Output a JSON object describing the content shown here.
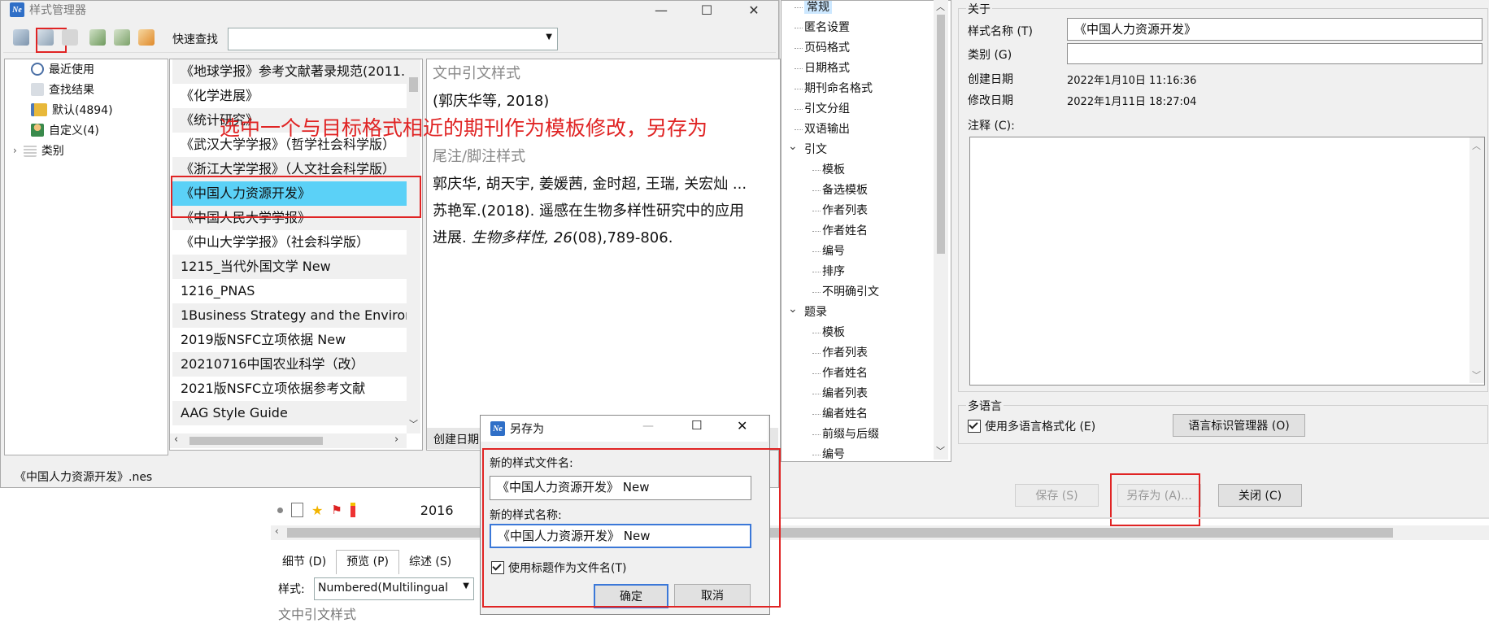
{
  "style_manager": {
    "title": "样式管理器",
    "quick_find_label": "快速查找",
    "quick_find_value": "",
    "tree": [
      {
        "label": "最近使用"
      },
      {
        "label": "查找结果"
      },
      {
        "label": "默认(4894)"
      },
      {
        "label": "自定义(4)"
      },
      {
        "label": "类别"
      }
    ],
    "styles": [
      "《地球学报》参考文献著录规范(2011.",
      "《化学进展》",
      "《统计研究》",
      "《武汉大学学报》（哲学社会科学版）",
      "《浙江大学学报》（人文社会科学版）",
      "《中国人力资源开发》",
      "《中国人民大学学报》",
      "《中山大学学报》（社会科学版）",
      "1215_当代外国文学 New",
      "1216_PNAS",
      "1Business Strategy and the Environm",
      "2019版NSFC立项依据 New",
      "20210716中国农业科学（改）",
      "2021版NSFC立项依据参考文献",
      "AAG Style Guide"
    ],
    "preview": {
      "intext_heading": "文中引文样式",
      "intext_sample": "(郭庆华等, 2018)",
      "note_heading": "尾注/脚注样式",
      "ref_line1": "郭庆华, 胡天宇, 姜媛茜, 金时超, 王瑞, 关宏灿 ...",
      "ref_line2": "苏艳军.(2018). 遥感在生物多样性研究中的应用",
      "ref_line3_plain": "进展. ",
      "ref_line3_journal": "生物多样性, 26",
      "ref_line3_rest": "(08),789-806.",
      "created_label": "创建日期"
    },
    "status_file": "《中国人力资源开发》.nes"
  },
  "annotation_text": "选中一个与目标格式相近的期刊作为模板修改，另存为",
  "editor_tree": [
    {
      "label": "常规",
      "level": 0,
      "selected": true
    },
    {
      "label": "匿名设置",
      "level": 0
    },
    {
      "label": "页码格式",
      "level": 0
    },
    {
      "label": "日期格式",
      "level": 0
    },
    {
      "label": "期刊命名格式",
      "level": 0
    },
    {
      "label": "引文分组",
      "level": 0
    },
    {
      "label": "双语输出",
      "level": 0
    },
    {
      "label": "引文",
      "level": 0,
      "expander": true
    },
    {
      "label": "模板",
      "level": 1
    },
    {
      "label": "备选模板",
      "level": 1
    },
    {
      "label": "作者列表",
      "level": 1
    },
    {
      "label": "作者姓名",
      "level": 1
    },
    {
      "label": "编号",
      "level": 1
    },
    {
      "label": "排序",
      "level": 1
    },
    {
      "label": "不明确引文",
      "level": 1
    },
    {
      "label": "题录",
      "level": 0,
      "expander": true
    },
    {
      "label": "模板",
      "level": 1
    },
    {
      "label": "作者列表",
      "level": 1
    },
    {
      "label": "作者姓名",
      "level": 1
    },
    {
      "label": "编者列表",
      "level": 1
    },
    {
      "label": "编者姓名",
      "level": 1
    },
    {
      "label": "前缀与后缀",
      "level": 1
    },
    {
      "label": "编号",
      "level": 1
    }
  ],
  "about": {
    "group_label": "关于",
    "style_name_label": "样式名称 (T)",
    "style_name_value": "《中国人力资源开发》",
    "category_label": "类别 (G)",
    "category_value": "",
    "created_label": "创建日期",
    "created_value": "2022年1月10日 11:16:36",
    "modified_label": "修改日期",
    "modified_value": "2022年1月11日 18:27:04",
    "notes_label": "注释 (C):"
  },
  "multilang": {
    "group_label": "多语言",
    "checkbox_label": "使用多语言格式化 (E)",
    "manager_button": "语言标识管理器 (O)"
  },
  "editor_buttons": {
    "save": "保存 (S)",
    "save_as": "另存为 (A)...",
    "close": "关闭 (C)"
  },
  "background": {
    "row_years": [
      "2016"
    ],
    "tabs": [
      "细节 (D)",
      "预览 (P)",
      "综述 (S)"
    ],
    "style_label": "样式:",
    "style_value": "Numbered(Multilingual",
    "bottom_text": "文中引文样式"
  },
  "save_as_dialog": {
    "title": "另存为",
    "file_label": "新的样式文件名:",
    "file_value": "《中国人力资源开发》 New",
    "name_label": "新的样式名称:",
    "name_value": "《中国人力资源开发》 New",
    "checkbox_label": "使用标题作为文件名(T)",
    "ok": "确定",
    "cancel": "取消"
  },
  "colors": {
    "selection": "#5bd1f7",
    "annotation_red": "#e02424",
    "app_icon": "#2f6fc7"
  }
}
